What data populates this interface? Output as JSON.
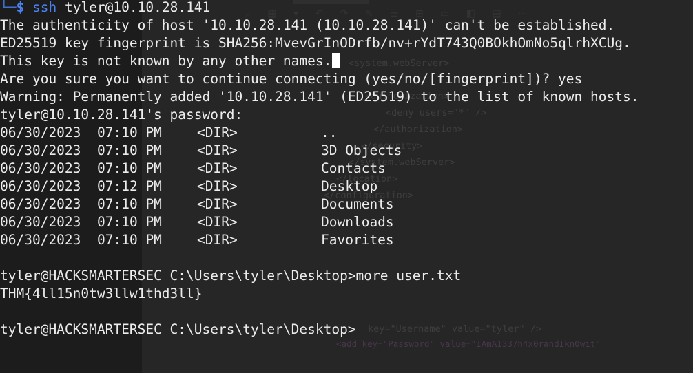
{
  "window": {
    "app": "terminal"
  },
  "background_editor": {
    "lines": [
      "<system.webServer>",
      "<authorization>",
      "<deny users=\"*\" />",
      "</authorization>",
      "</security>",
      "</system.webServer>",
      "</location>",
      "</configuration>"
    ],
    "username_line": "key=\"Username\" value=\"tyler\" />",
    "password_line": "<add key=\"Password\" value=\"IAmA1337h4x0randIkn0wit\""
  },
  "terminal": {
    "prompt_corner": "└─",
    "prompt_symbol": "$",
    "ssh_command": "ssh",
    "ssh_target": "tyler@10.10.28.141",
    "messages": [
      "The authenticity of host '10.10.28.141 (10.10.28.141)' can't be established.",
      "ED25519 key fingerprint is SHA256:MvevGrInODrfb/nv+rYdT743Q0BOkhOmNo5qlrhXCUg.",
      "This key is not known by any other names.",
      "Are you sure you want to continue connecting (yes/no/[fingerprint])? yes",
      "Warning: Permanently added '10.10.28.141' (ED25519) to the list of known hosts.",
      "tyler@10.10.28.141's password:"
    ],
    "dir_listing": [
      {
        "date": "06/30/2023",
        "time": "07:10 PM",
        "type": "<DIR>",
        "name": ".."
      },
      {
        "date": "06/30/2023",
        "time": "07:10 PM",
        "type": "<DIR>",
        "name": "3D Objects"
      },
      {
        "date": "06/30/2023",
        "time": "07:10 PM",
        "type": "<DIR>",
        "name": "Contacts"
      },
      {
        "date": "06/30/2023",
        "time": "07:12 PM",
        "type": "<DIR>",
        "name": "Desktop"
      },
      {
        "date": "06/30/2023",
        "time": "07:10 PM",
        "type": "<DIR>",
        "name": "Documents"
      },
      {
        "date": "06/30/2023",
        "time": "07:10 PM",
        "type": "<DIR>",
        "name": "Downloads"
      },
      {
        "date": "06/30/2023",
        "time": "07:10 PM",
        "type": "<DIR>",
        "name": "Favorites"
      }
    ],
    "more_command": "tyler@HACKSMARTERSEC C:\\Users\\tyler\\Desktop>more user.txt",
    "flag": "THM{4ll15n0tw3llw1thd3ll}",
    "final_prompt": "tyler@HACKSMARTERSEC C:\\Users\\tyler\\Desktop>"
  }
}
